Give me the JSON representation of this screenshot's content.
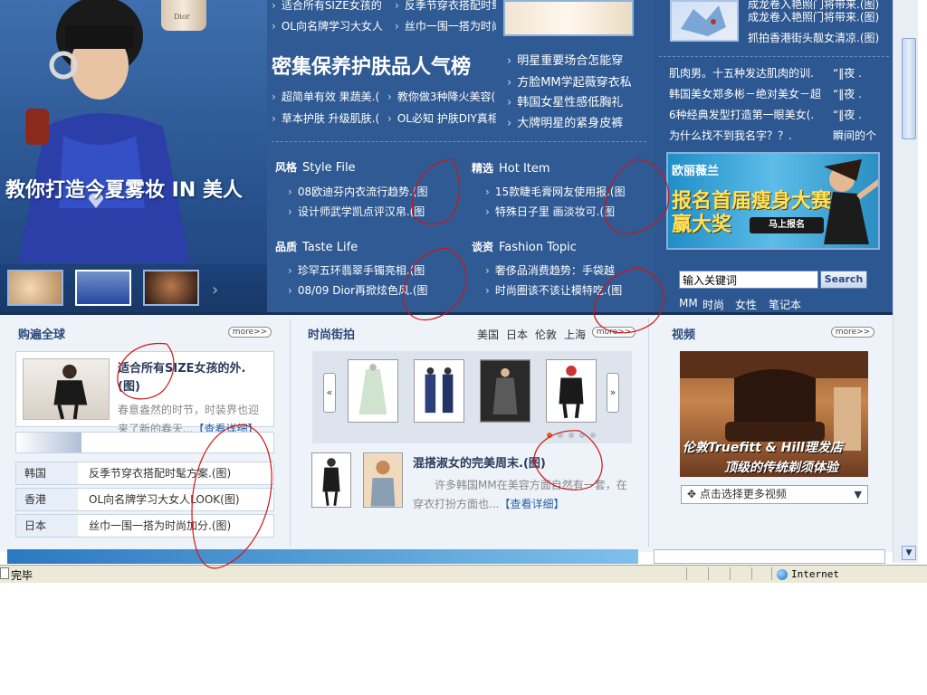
{
  "browser": {
    "status": "完毕",
    "zone": "Internet"
  },
  "hero": {
    "caption": "教你打造今夏雾妆 IN 美人",
    "dior_label": "Dior"
  },
  "top_links": [
    {
      "left": "适合所有SIZE女孩的",
      "right": "反季节穿衣搭配时髦"
    },
    {
      "left": "OL向名牌学习大女人",
      "right": "丝巾一围一搭为时尚"
    }
  ],
  "headline": "密集保养护肤品人气榜",
  "headline_links": [
    {
      "left": "超简单有效 果蔬美.(",
      "right": "教你做3种降火美容("
    },
    {
      "left": "草本护肤 升级肌肤.(",
      "right": "OL必知 护肤DIY真相"
    }
  ],
  "mid_links": [
    "明星重要场合怎能穿",
    "方脸MM学起薇穿衣私",
    "韩国女星性感低胸礼",
    "大牌明星的紧身皮裤"
  ],
  "sections": [
    {
      "cn": "风格",
      "en": "Style File",
      "items": [
        "08欧迪芬内衣流行趋势.(图",
        "设计师武学凯点评汉帛.(图"
      ]
    },
    {
      "cn": "精选",
      "en": "Hot Item",
      "items": [
        "15款睫毛膏网友使用报.(图",
        "特殊日子里 画淡妆可.(图"
      ]
    },
    {
      "cn": "品质",
      "en": "Taste Life",
      "items": [
        "珍罕五环翡翠手镯亮相.(图",
        "08/09 Dior再掀炫色风.(图"
      ]
    },
    {
      "cn": "谈资",
      "en": "Fashion Topic",
      "items": [
        "奢侈品消费趋势：手袋越",
        "时尚圈该不该让模特吃.(图"
      ]
    }
  ],
  "right_top": [
    "成龙卷入艳照门将带来.(图)",
    "抓拍香港街头靓女清凉.(图)"
  ],
  "right_list": [
    {
      "left": "肌肉男。十五种发达肌肉的训.",
      "right": "“‖夜 ."
    },
    {
      "left": "韩国美女郑多彬－绝对美女－超",
      "right": "“‖夜 ."
    },
    {
      "left": "6种经典发型打造第一眼美女(.",
      "right": "“‖夜 ."
    },
    {
      "left": "为什么找不到我名字？？.",
      "right": "瞬间的个"
    }
  ],
  "ad": {
    "brand": "欧丽薇兰",
    "line1": "报名首届瘦身大赛",
    "line2": "赢大奖",
    "button": "马上报名"
  },
  "search": {
    "value": "输入关键词",
    "button": "Search",
    "tags": [
      "MM",
      "时尚",
      "女性",
      "笔记本"
    ]
  },
  "global": {
    "title": "购遍全球",
    "more": "more>>",
    "card_title": "适合所有SIZE女孩的外.(图)",
    "card_desc": "春意盎然的时节，时装界也迎来了新的春天...",
    "card_link": "【查看详细】",
    "rows": [
      {
        "k": "韩国",
        "v": "反季节穿衣搭配时髦方案.(图)"
      },
      {
        "k": "香港",
        "v": "OL向名牌学习大女人LOOK(图)"
      },
      {
        "k": "日本",
        "v": "丝巾一围一搭为时尚加分.(图)"
      }
    ]
  },
  "street": {
    "title": "时尚街拍",
    "regions": [
      "美国",
      "日本",
      "伦敦",
      "上海"
    ],
    "more": "more>>",
    "prev": "«",
    "next": "»",
    "story_title": "混搭淑女的完美周末.(图)",
    "story_desc": "许多韩国MM在美容方面自然有一套，在穿衣打扮方面也...",
    "story_link": "【查看详细】"
  },
  "video": {
    "title": "视频",
    "more": "more>>",
    "cap1": "伦敦Truefitt & Hill理发店",
    "cap2": "顶级的传统剃须体验",
    "select": "点击选择更多视频"
  }
}
